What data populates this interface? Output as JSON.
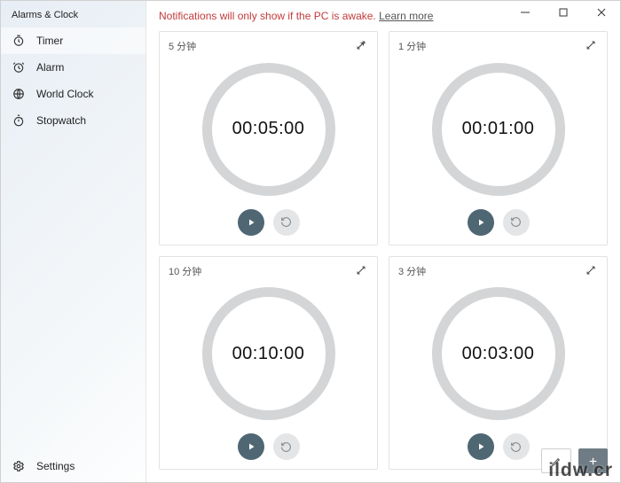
{
  "app_title": "Alarms & Clock",
  "sidebar": {
    "items": [
      {
        "label": "Timer"
      },
      {
        "label": "Alarm"
      },
      {
        "label": "World Clock"
      },
      {
        "label": "Stopwatch"
      }
    ],
    "settings_label": "Settings"
  },
  "notice": {
    "text": "Notifications will only show if the PC is awake. ",
    "link": "Learn more"
  },
  "timers": [
    {
      "title": "5 分钟",
      "time": "00:05:00"
    },
    {
      "title": "1 分钟",
      "time": "00:01:00"
    },
    {
      "title": "10 分钟",
      "time": "00:10:00"
    },
    {
      "title": "3 分钟",
      "time": "00:03:00"
    }
  ],
  "footer": {
    "add_label": "+"
  },
  "watermark": "ildw.cr"
}
